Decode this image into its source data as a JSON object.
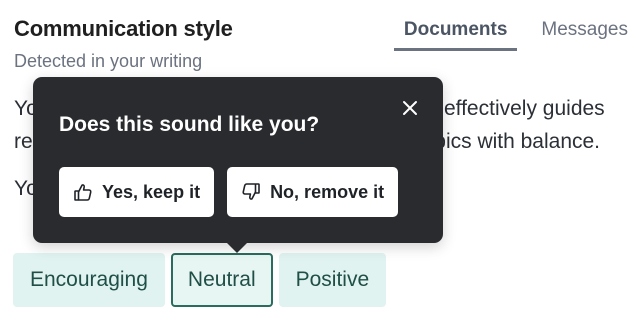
{
  "header": {
    "title": "Communication style",
    "subtitle": "Detected in your writing"
  },
  "tabs": [
    {
      "label": "Documents",
      "active": true
    },
    {
      "label": "Messages",
      "active": false
    }
  ],
  "body": {
    "paragraph1": "Your writing shows a clear and neutral tone. It effectively guides readers through technical and professional topics with balance.",
    "paragraph2": "Your tone is consistent across documents."
  },
  "tags": [
    {
      "label": "Encouraging",
      "selected": false
    },
    {
      "label": "Neutral",
      "selected": true
    },
    {
      "label": "Positive",
      "selected": false
    }
  ],
  "popover": {
    "title": "Does this sound like you?",
    "close_icon": "close-icon",
    "yes_label": "Yes, keep it",
    "yes_icon": "thumbs-up-icon",
    "no_label": "No, remove it",
    "no_icon": "thumbs-down-icon"
  },
  "colors": {
    "tag_bg": "#e1f3f1",
    "tag_text": "#1f4f47",
    "tag_selected_border": "#2c6b5f",
    "popover_bg": "#2a2b2e"
  }
}
